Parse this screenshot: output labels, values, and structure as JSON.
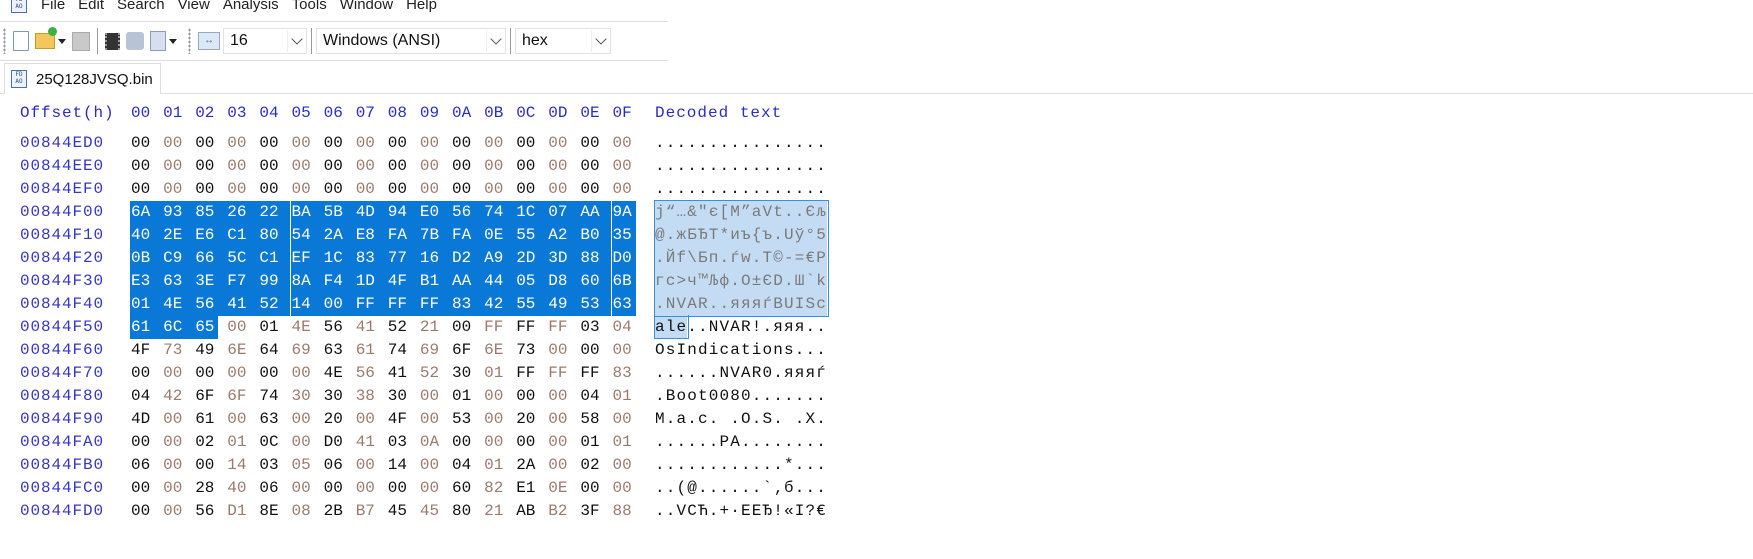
{
  "menubar": {
    "app_icon_text": "FD AO",
    "items": [
      "File",
      "Edit",
      "Search",
      "View",
      "Analysis",
      "Tools",
      "Window",
      "Help"
    ]
  },
  "toolbar": {
    "icons": [
      "new-file-icon",
      "open-file-icon",
      "save-icon",
      "open-disk-icon",
      "open-ram-icon",
      "open-file-list-icon",
      "bytes-per-row-icon"
    ],
    "bytes_per_row": "16",
    "charset": "Windows (ANSI)",
    "offset_base": "hex"
  },
  "tab": {
    "filename": "25Q128JVSQ.bin"
  },
  "editor": {
    "offset_header": "Offset(h)",
    "column_headers": [
      "00",
      "01",
      "02",
      "03",
      "04",
      "05",
      "06",
      "07",
      "08",
      "09",
      "0A",
      "0B",
      "0C",
      "0D",
      "0E",
      "0F"
    ],
    "decoded_header": "Decoded text",
    "selection": {
      "start_offset": "00844F00",
      "end_offset": "00844F52"
    },
    "colors": {
      "selection": "#0a78d7",
      "offset": "#3535c8",
      "odd_column": "#9b7b6e"
    },
    "rows": [
      {
        "offset": "00844ED0",
        "bytes": "00 00 00 00 00 00 00 00 00 00 00 00 00 00 00 00",
        "text": "................"
      },
      {
        "offset": "00844EE0",
        "bytes": "00 00 00 00 00 00 00 00 00 00 00 00 00 00 00 00",
        "text": "................"
      },
      {
        "offset": "00844EF0",
        "bytes": "00 00 00 00 00 00 00 00 00 00 00 00 00 00 00 00",
        "text": "................"
      },
      {
        "offset": "00844F00",
        "bytes": "6A 93 85 26 22 BA 5B 4D 94 E0 56 74 1C 07 AA 9A",
        "text": "j“…&\"є[M”аVt..Єљ"
      },
      {
        "offset": "00844F10",
        "bytes": "40 2E E6 C1 80 54 2A E8 FA 7B FA 0E 55 A2 B0 35",
        "text": "@.жБЂT*иъ{ъ.Uў°5"
      },
      {
        "offset": "00844F20",
        "bytes": "0B C9 66 5C C1 EF 1C 83 77 16 D2 A9 2D 3D 88 D0",
        "text": ".Йf\\Бп.ѓw.Т©-=€Р"
      },
      {
        "offset": "00844F30",
        "bytes": "E3 63 3E F7 99 8A F4 1D 4F B1 AA 44 05 D8 60 6B",
        "text": "гc>ч™Љф.O±ЄD.Ш`k"
      },
      {
        "offset": "00844F40",
        "bytes": "01 4E 56 41 52 14 00 FF FF FF 83 42 55 49 53 63",
        "text": ".NVAR..яяяѓBUISc"
      },
      {
        "offset": "00844F50",
        "bytes": "61 6C 65 00 01 4E 56 41 52 21 00 FF FF FF 03 04",
        "text": "ale..NVAR!.яяя.."
      },
      {
        "offset": "00844F60",
        "bytes": "4F 73 49 6E 64 69 63 61 74 69 6F 6E 73 00 00 00",
        "text": "OsIndications..."
      },
      {
        "offset": "00844F70",
        "bytes": "00 00 00 00 00 00 4E 56 41 52 30 01 FF FF FF 83",
        "text": "......NVAR0.яяяѓ"
      },
      {
        "offset": "00844F80",
        "bytes": "04 42 6F 6F 74 30 30 38 30 00 01 00 00 00 04 01",
        "text": ".Boot0080......."
      },
      {
        "offset": "00844F90",
        "bytes": "4D 00 61 00 63 00 20 00 4F 00 53 00 20 00 58 00",
        "text": "M.a.c. .O.S. .X."
      },
      {
        "offset": "00844FA0",
        "bytes": "00 00 02 01 0C 00 D0 41 03 0A 00 00 00 00 01 01",
        "text": "......РA........"
      },
      {
        "offset": "00844FB0",
        "bytes": "06 00 00 14 03 05 06 00 14 00 04 01 2A 00 02 00",
        "text": "............*..."
      },
      {
        "offset": "00844FC0",
        "bytes": "00 00 28 40 06 00 00 00 00 00 60 82 E1 0E 00 00",
        "text": "..(@......`‚б..."
      },
      {
        "offset": "00844FD0",
        "bytes": "00 00 56 D1 8E 08 2B B7 45 45 80 21 AB B2 3F 88",
        "text": "..VСЋ.+·EEЂ!«І?€"
      }
    ]
  }
}
